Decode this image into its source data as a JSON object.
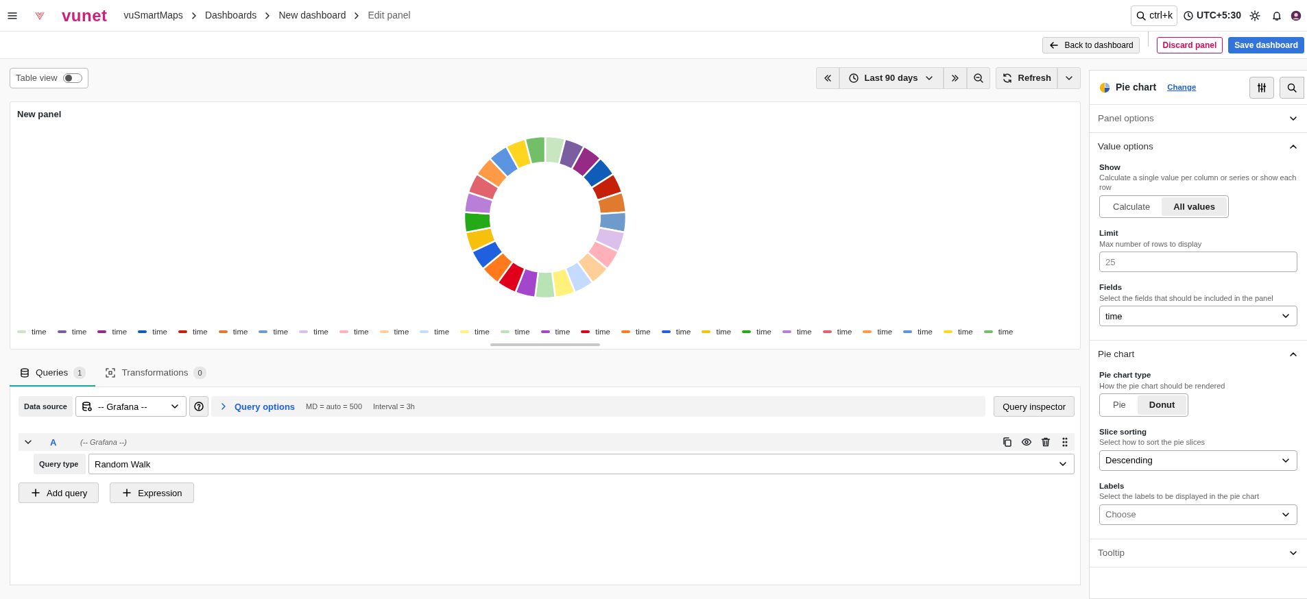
{
  "header": {
    "brand": "vunet",
    "breadcrumbs": [
      "vuSmartMaps",
      "Dashboards",
      "New dashboard",
      "Edit panel"
    ],
    "search_shortcut": "ctrl+k",
    "timezone": "UTC+5:30"
  },
  "actions": [
    {
      "label": "Back to dashboard",
      "kind": "back"
    },
    {
      "label": "Discard panel",
      "kind": "discard"
    },
    {
      "label": "Save dashboard",
      "kind": "save"
    }
  ],
  "toolbar": {
    "table_view": {
      "label": "Table view",
      "on": false
    },
    "time_range": "Last 90 days",
    "refresh": "Refresh"
  },
  "panel": {
    "title": "New panel",
    "legend": [
      {
        "label": "time",
        "color": "#c8e6c0"
      },
      {
        "label": "time",
        "color": "#7b5ea0"
      },
      {
        "label": "time",
        "color": "#972a84"
      },
      {
        "label": "time",
        "color": "#0f5db8"
      },
      {
        "label": "time",
        "color": "#c4200a"
      },
      {
        "label": "time",
        "color": "#e07a2e"
      },
      {
        "label": "time",
        "color": "#6f9bcc"
      },
      {
        "label": "time",
        "color": "#dcc0ec"
      },
      {
        "label": "time",
        "color": "#ffb0b8"
      },
      {
        "label": "time",
        "color": "#ffcf99"
      },
      {
        "label": "time",
        "color": "#c4dbff"
      },
      {
        "label": "time",
        "color": "#fff17a"
      },
      {
        "label": "time",
        "color": "#b8e3b4"
      },
      {
        "label": "time",
        "color": "#a346cc"
      },
      {
        "label": "time",
        "color": "#e0001b"
      },
      {
        "label": "time",
        "color": "#ff7a1c"
      },
      {
        "label": "time",
        "color": "#1f60de"
      },
      {
        "label": "time",
        "color": "#f6c00c"
      },
      {
        "label": "time",
        "color": "#24a919"
      },
      {
        "label": "time",
        "color": "#b97ed8"
      },
      {
        "label": "time",
        "color": "#e0636e"
      },
      {
        "label": "time",
        "color": "#ff9a47"
      },
      {
        "label": "time",
        "color": "#5b94e0"
      },
      {
        "label": "time",
        "color": "#ffd61f"
      },
      {
        "label": "time",
        "color": "#73bf69"
      }
    ]
  },
  "tabs": [
    {
      "label": "Queries",
      "count": "1",
      "selected": true,
      "kind": "queries"
    },
    {
      "label": "Transformations",
      "count": "0",
      "selected": false,
      "kind": "transform"
    }
  ],
  "query_bar": {
    "data_source_label": "Data source",
    "data_source": "-- Grafana --",
    "options_label": "Query options",
    "options_info": [
      "MD = auto = 500",
      "Interval = 3h"
    ],
    "inspector": "Query inspector"
  },
  "queries": [
    {
      "ref": "A",
      "source": "(-- Grafana --)",
      "expanded": true,
      "fields": [
        {
          "label": "Query type",
          "value": "Random Walk"
        }
      ]
    }
  ],
  "query_buttons": [
    "Add query",
    "Expression"
  ],
  "options_pane": {
    "viz": "Pie chart",
    "change": "Change",
    "sections": [
      {
        "title": "Panel options",
        "expanded": false
      },
      {
        "title": "Value options",
        "expanded": true,
        "items": [
          {
            "kind": "radio",
            "label": "Show",
            "description": "Calculate a single value per column or series or show each row",
            "options": [
              {
                "label": "Calculate",
                "selected": false
              },
              {
                "label": "All values",
                "selected": true
              }
            ]
          },
          {
            "kind": "input",
            "label": "Limit",
            "description": "Max number of rows to display",
            "placeholder": "25"
          },
          {
            "kind": "select",
            "label": "Fields",
            "description": "Select the fields that should be included in the panel",
            "value": "time"
          }
        ]
      },
      {
        "title": "Pie chart",
        "expanded": true,
        "items": [
          {
            "kind": "radio",
            "label": "Pie chart type",
            "description": "How the pie chart should be rendered",
            "options": [
              {
                "label": "Pie",
                "selected": false
              },
              {
                "label": "Donut",
                "selected": true
              }
            ]
          },
          {
            "kind": "select",
            "label": "Slice sorting",
            "description": "Select how to sort the pie slices",
            "value": "Descending"
          },
          {
            "kind": "select",
            "label": "Labels",
            "description": "Select the labels to be displayed in the pie chart",
            "placeholder": "Choose"
          }
        ]
      },
      {
        "title": "Tooltip",
        "expanded": false
      }
    ]
  }
}
